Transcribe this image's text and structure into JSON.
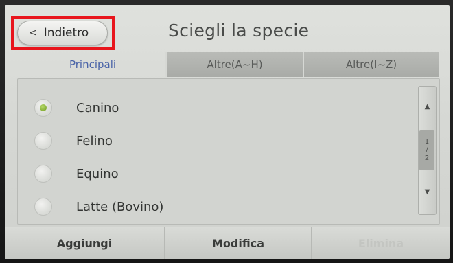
{
  "header": {
    "back_label": "Indietro",
    "back_chevron": "<",
    "title": "Sciegli la specie"
  },
  "tabs": [
    {
      "label": "Principali",
      "active": true
    },
    {
      "label": "Altre(A~H)",
      "active": false
    },
    {
      "label": "Altre(I~Z)",
      "active": false
    }
  ],
  "species": [
    {
      "label": "Canino",
      "selected": true
    },
    {
      "label": "Felino",
      "selected": false
    },
    {
      "label": "Equino",
      "selected": false
    },
    {
      "label": "Latte (Bovino)",
      "selected": false
    }
  ],
  "pagination": {
    "current": "1",
    "separator": "/",
    "total": "2"
  },
  "actions": {
    "add_label": "Aggiungi",
    "edit_label": "Modifica",
    "delete_label": "Elimina",
    "delete_enabled": false
  },
  "colors": {
    "highlight": "#e8151c",
    "active_tab_text": "#4a64a8",
    "radio_selected": "#6e9a1e"
  }
}
